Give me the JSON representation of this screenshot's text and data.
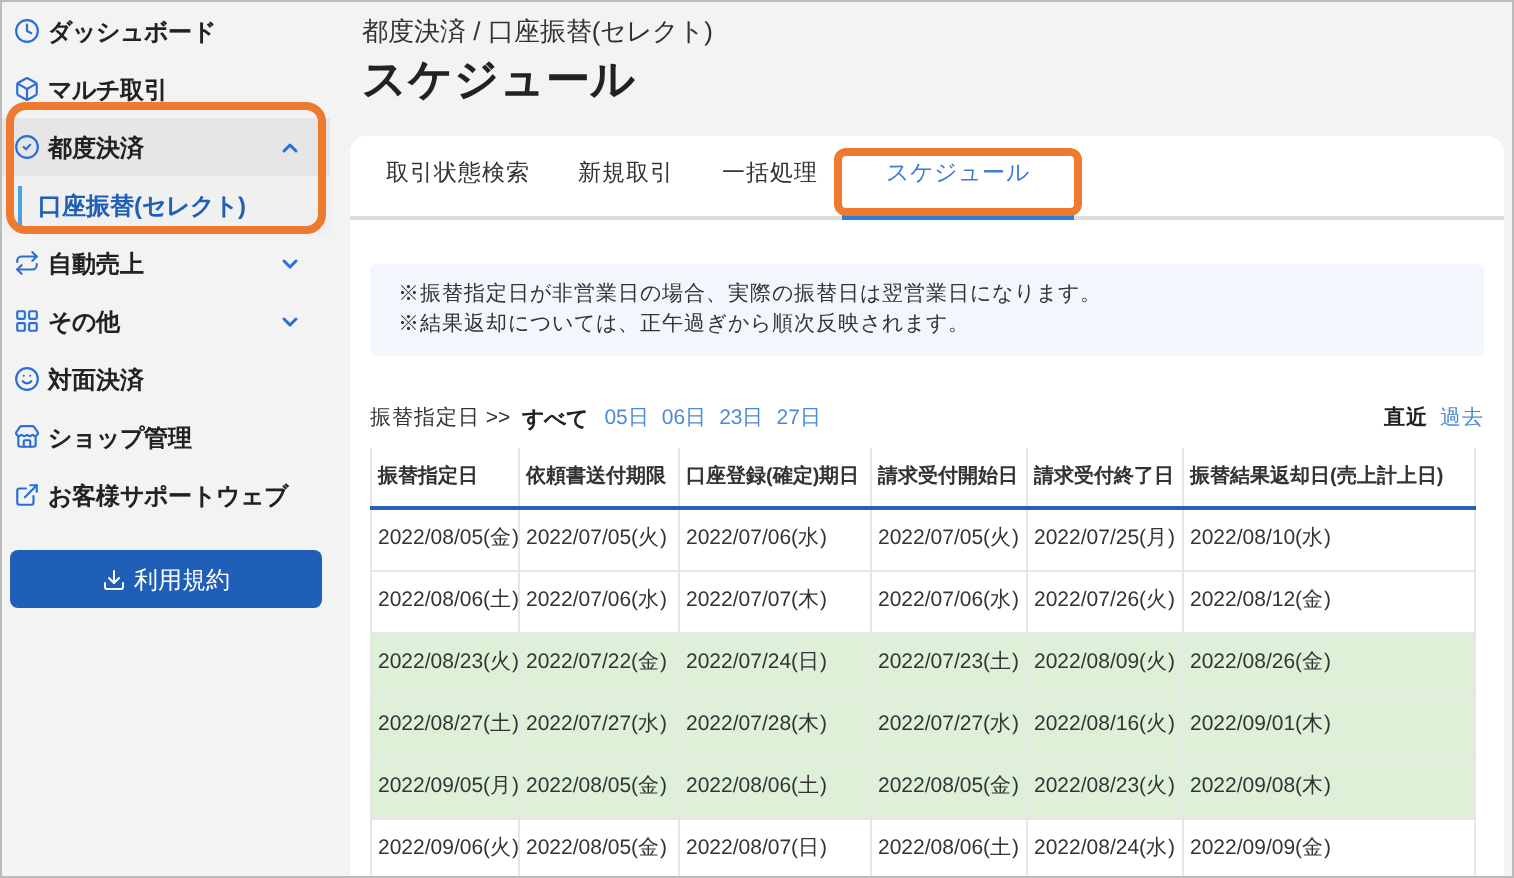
{
  "sidebar": {
    "items": [
      {
        "kind": "link",
        "label": "ダッシュボード"
      },
      {
        "kind": "link",
        "label": "マルチ取引"
      },
      {
        "kind": "group",
        "label": "都度決済",
        "expanded": true,
        "callout": true,
        "children": [
          {
            "label": "口座振替(セレクト)",
            "selected": true
          }
        ]
      },
      {
        "kind": "group",
        "label": "自動売上",
        "expanded": false
      },
      {
        "kind": "group",
        "label": "その他",
        "expanded": false
      },
      {
        "kind": "link",
        "label": "対面決済"
      },
      {
        "kind": "link",
        "label": "ショップ管理"
      },
      {
        "kind": "link",
        "label": "お客様サポートウェブ"
      }
    ],
    "button": "利用規約"
  },
  "breadcrumb": "都度決済 / 口座振替(セレクト)",
  "title": "スケジュール",
  "tabs": [
    {
      "label": "取引状態検索",
      "selected": false,
      "callout": false
    },
    {
      "label": "新規取引",
      "selected": false,
      "callout": false
    },
    {
      "label": "一括処理",
      "selected": false,
      "callout": false
    },
    {
      "label": "スケジュール",
      "selected": true,
      "callout": true
    }
  ],
  "notice": [
    "※振替指定日が非営業日の場合、実際の振替日は翌営業日になります。",
    "※結果返却については、正午過ぎから順次反映されます。"
  ],
  "filter": {
    "label": "振替指定日 >>",
    "options": [
      {
        "label": "すべて",
        "selected": true
      },
      {
        "label": "05日",
        "selected": false
      },
      {
        "label": "06日",
        "selected": false
      },
      {
        "label": "23日",
        "selected": false
      },
      {
        "label": "27日",
        "selected": false
      }
    ],
    "periods": [
      {
        "label": "直近",
        "selected": true
      },
      {
        "label": "過去",
        "selected": false
      }
    ]
  },
  "table": {
    "columns": [
      "振替指定日",
      "依頼書送付期限",
      "口座登録(確定)期日",
      "請求受付開始日",
      "請求受付終了日",
      "振替結果返却日(売上計上日)"
    ],
    "rows": [
      {
        "highlighted": false,
        "cells": [
          "2022/08/05(金)",
          "2022/07/05(火)",
          "2022/07/06(水)",
          "2022/07/05(火)",
          "2022/07/25(月)",
          "2022/08/10(水)"
        ]
      },
      {
        "highlighted": false,
        "cells": [
          "2022/08/06(土)",
          "2022/07/06(水)",
          "2022/07/07(木)",
          "2022/07/06(水)",
          "2022/07/26(火)",
          "2022/08/12(金)"
        ]
      },
      {
        "highlighted": true,
        "cells": [
          "2022/08/23(火)",
          "2022/07/22(金)",
          "2022/07/24(日)",
          "2022/07/23(土)",
          "2022/08/09(火)",
          "2022/08/26(金)"
        ]
      },
      {
        "highlighted": true,
        "cells": [
          "2022/08/27(土)",
          "2022/07/27(水)",
          "2022/07/28(木)",
          "2022/07/27(水)",
          "2022/08/16(火)",
          "2022/09/01(木)"
        ]
      },
      {
        "highlighted": true,
        "cells": [
          "2022/09/05(月)",
          "2022/08/05(金)",
          "2022/08/06(土)",
          "2022/08/05(金)",
          "2022/08/23(火)",
          "2022/09/08(木)"
        ]
      },
      {
        "highlighted": false,
        "cells": [
          "2022/09/06(火)",
          "2022/08/05(金)",
          "2022/08/07(日)",
          "2022/08/06(土)",
          "2022/08/24(水)",
          "2022/09/09(金)"
        ]
      }
    ]
  }
}
